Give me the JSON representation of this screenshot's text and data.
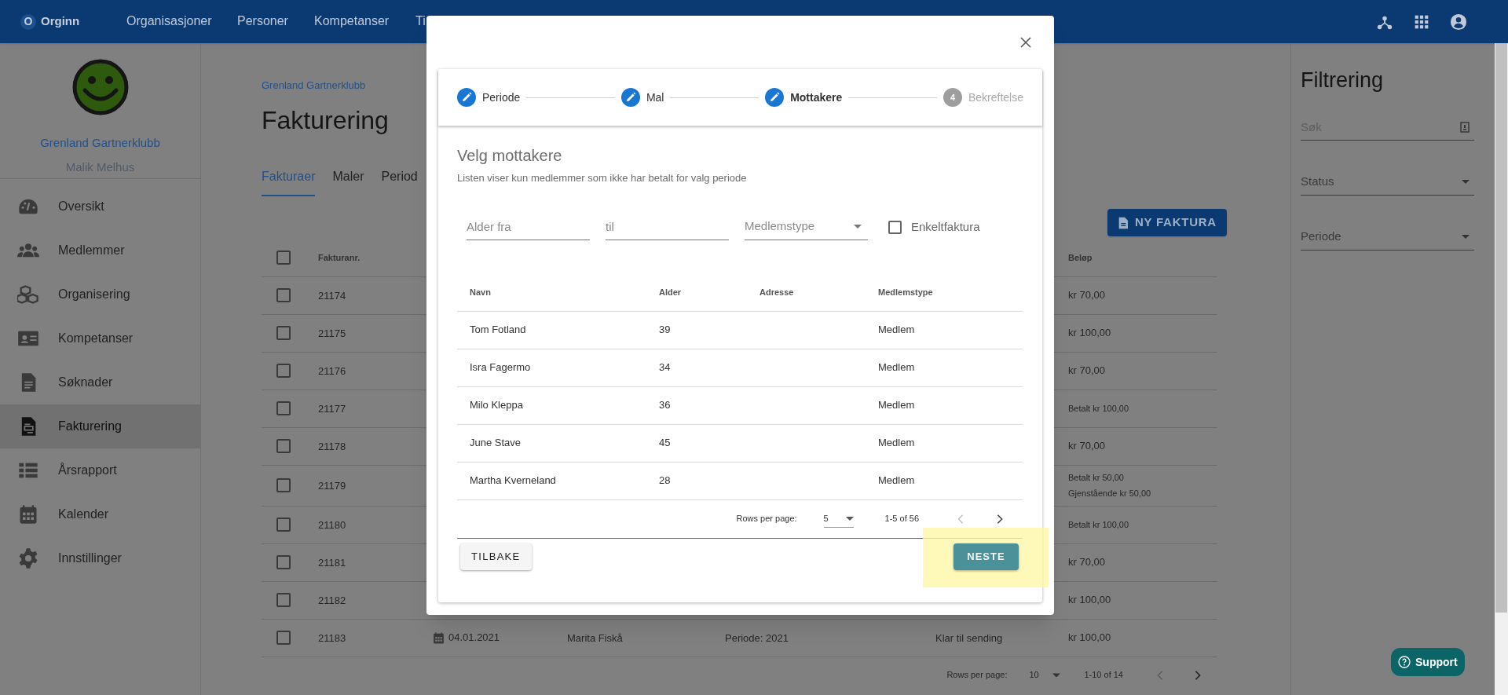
{
  "topbar": {
    "logo_letter": "O",
    "brand": "Orginn",
    "nav": [
      "Organisasjoner",
      "Personer",
      "Kompetanser",
      "Ti"
    ]
  },
  "sidebar": {
    "org": "Grenland Gartnerklubb",
    "user": "Malik Melhus",
    "items": [
      {
        "label": "Oversikt",
        "kind": "gauge",
        "selected": false
      },
      {
        "label": "Medlemmer",
        "kind": "people",
        "selected": false
      },
      {
        "label": "Organisering",
        "kind": "boxes",
        "selected": false
      },
      {
        "label": "Kompetanser",
        "kind": "card",
        "selected": false
      },
      {
        "label": "Søknader",
        "kind": "document",
        "selected": false
      },
      {
        "label": "Fakturering",
        "kind": "invoice",
        "selected": true
      },
      {
        "label": "Årsrapport",
        "kind": "list",
        "selected": false
      },
      {
        "label": "Kalender",
        "kind": "calendar",
        "selected": false
      },
      {
        "label": "Innstillinger",
        "kind": "gear",
        "selected": false
      }
    ]
  },
  "main": {
    "breadcrumb": "Grenland Gartnerklubb",
    "title": "Fakturering",
    "tabs": [
      {
        "label": "Fakturaer",
        "selected": true
      },
      {
        "label": "Maler",
        "selected": false
      },
      {
        "label": "Period",
        "selected": false
      }
    ],
    "new_button": "NY FAKTURA",
    "table": {
      "all_checked": false,
      "columns": [
        "Fakturanr.",
        "Beløp"
      ],
      "rows": [
        {
          "checked": false,
          "number": "21174",
          "amount": {
            "kind": "sum",
            "lines": [
              "kr 70,00"
            ]
          }
        },
        {
          "checked": false,
          "number": "21175",
          "amount": {
            "kind": "sum",
            "lines": [
              "kr 100,00"
            ]
          }
        },
        {
          "checked": false,
          "number": "21176",
          "amount": {
            "kind": "sum",
            "lines": [
              "kr 70,00"
            ]
          }
        },
        {
          "checked": false,
          "number": "21177",
          "amount": {
            "kind": "paid",
            "lines": [
              "Betalt kr 100,00"
            ]
          }
        },
        {
          "checked": false,
          "number": "21178",
          "amount": {
            "kind": "sum",
            "lines": [
              "kr 70,00"
            ]
          }
        },
        {
          "checked": false,
          "number": "21179",
          "amount": {
            "kind": "paid",
            "lines": [
              "Betalt kr 50,00",
              "Gjenstående kr 50,00"
            ]
          }
        },
        {
          "checked": false,
          "number": "21180",
          "amount": {
            "kind": "paid",
            "lines": [
              "Betalt kr 100,00"
            ]
          }
        },
        {
          "checked": false,
          "number": "21181",
          "amount": {
            "kind": "sum",
            "lines": [
              "kr 70,00"
            ]
          }
        },
        {
          "checked": false,
          "number": "21182",
          "amount": {
            "kind": "sum",
            "lines": [
              "kr 100,00"
            ]
          }
        },
        {
          "checked": false,
          "number": "21183",
          "date": "04.01.2021",
          "name": "Marita Fiskå",
          "period": "Periode: 2021",
          "status": "Klar til sending",
          "amount": {
            "kind": "sum",
            "lines": [
              "kr 100,00"
            ]
          }
        }
      ]
    },
    "pagination": {
      "label": "Rows per page:",
      "per_page": "10",
      "range": "1-10 of 14"
    }
  },
  "filter": {
    "title": "Filtrering",
    "search_placeholder": "Søk",
    "selects": [
      "Status",
      "Periode"
    ]
  },
  "support": "Support",
  "dialog": {
    "steps": [
      {
        "label": "Periode",
        "kind": "edit",
        "selected": false,
        "disabled": false
      },
      {
        "label": "Mal",
        "kind": "edit",
        "selected": false,
        "disabled": false
      },
      {
        "label": "Mottakere",
        "kind": "edit",
        "selected": true,
        "disabled": false
      },
      {
        "label": "Bekreftelse",
        "kind": "number",
        "number": "4",
        "selected": false,
        "disabled": true
      }
    ],
    "heading": "Velg mottakere",
    "subheading": "Listen viser kun medlemmer som ikke har betalt for valg periode",
    "filters": {
      "age_from": {
        "placeholder": "Alder fra"
      },
      "age_to": {
        "placeholder": "til"
      },
      "type": "Medlemstype",
      "single": {
        "label": "Enkeltfaktura",
        "checked": false
      }
    },
    "table": {
      "columns": [
        "Navn",
        "Alder",
        "Adresse",
        "Medlemstype"
      ],
      "rows": [
        {
          "name": "Tom Fotland",
          "age": "39",
          "type": "Medlem"
        },
        {
          "name": "Isra Fagermo",
          "age": "34",
          "type": "Medlem"
        },
        {
          "name": "Milo Kleppa",
          "age": "36",
          "type": "Medlem"
        },
        {
          "name": "June Stave",
          "age": "45",
          "type": "Medlem"
        },
        {
          "name": "Martha Kverneland",
          "age": "28",
          "type": "Medlem"
        }
      ]
    },
    "pagination": {
      "label": "Rows per page:",
      "per_page": "5",
      "range": "1-5 of 56"
    },
    "back": "TILBAKE",
    "next": {
      "label": "NESTE",
      "highlighted": true
    }
  }
}
